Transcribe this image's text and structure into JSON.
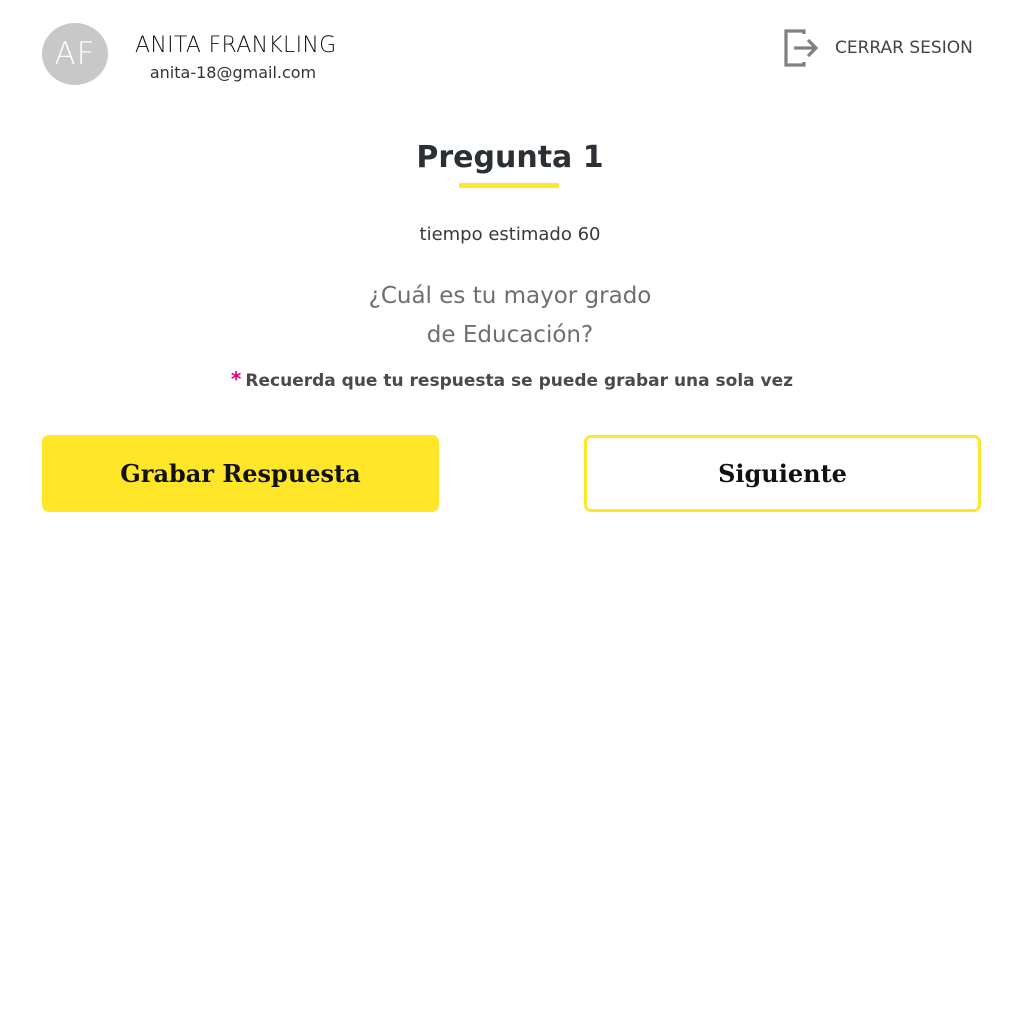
{
  "user": {
    "initials": "AF",
    "name": "ANITA FRANKLING",
    "email": "anita-18@gmail.com"
  },
  "header": {
    "logout_label": "CERRAR SESION",
    "logout_icon": "logout-icon"
  },
  "question": {
    "title": "Pregunta 1",
    "time_estimate": "tiempo estimado 60",
    "text_line1": "¿Cuál es tu mayor grado",
    "text_line2": "de Educación?",
    "reminder_marker": "*",
    "reminder": "Recuerda que tu respuesta se puede grabar una sola vez"
  },
  "actions": {
    "record_label": "Grabar Respuesta",
    "next_label": "Siguiente"
  },
  "colors": {
    "accent": "#ffe629",
    "asterisk": "#e6007e",
    "avatar_bg": "#c8c8c8"
  }
}
